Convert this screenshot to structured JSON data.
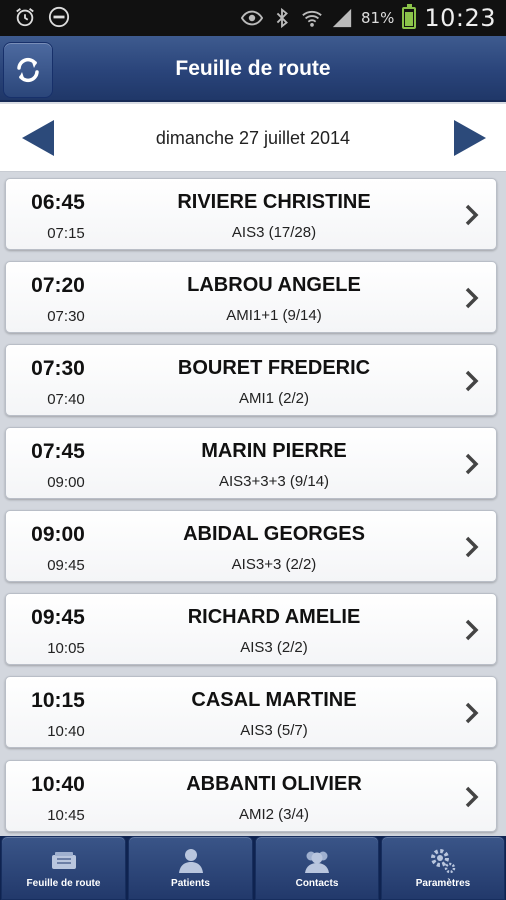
{
  "status_bar": {
    "battery_percent": "81%",
    "time": "10:23",
    "icons": [
      "alarm-icon",
      "do-not-disturb-icon",
      "eye-icon",
      "bluetooth-icon",
      "wifi-icon",
      "signal-icon",
      "battery-icon"
    ]
  },
  "header": {
    "title": "Feuille de route",
    "sync_icon": "sync-icon"
  },
  "date_nav": {
    "date": "dimanche 27 juillet 2014",
    "prev_icon": "arrow-left-icon",
    "next_icon": "arrow-right-icon"
  },
  "appointments": [
    {
      "start": "06:45",
      "end": "07:15",
      "patient": "RIVIERE CHRISTINE",
      "act": "AIS3 (17/28)"
    },
    {
      "start": "07:20",
      "end": "07:30",
      "patient": "LABROU ANGELE",
      "act": "AMI1+1 (9/14)"
    },
    {
      "start": "07:30",
      "end": "07:40",
      "patient": "BOURET FREDERIC",
      "act": "AMI1 (2/2)"
    },
    {
      "start": "07:45",
      "end": "09:00",
      "patient": "MARIN PIERRE",
      "act": "AIS3+3+3 (9/14)"
    },
    {
      "start": "09:00",
      "end": "09:45",
      "patient": "ABIDAL GEORGES",
      "act": "AIS3+3 (2/2)"
    },
    {
      "start": "09:45",
      "end": "10:05",
      "patient": "RICHARD AMELIE",
      "act": "AIS3 (2/2)"
    },
    {
      "start": "10:15",
      "end": "10:40",
      "patient": "CASAL MARTINE",
      "act": "AIS3 (5/7)"
    },
    {
      "start": "10:40",
      "end": "10:45",
      "patient": "ABBANTI OLIVIER",
      "act": "AMI2 (3/4)"
    }
  ],
  "tabs": [
    {
      "label": "Feuille de route",
      "icon": "roadmap-icon"
    },
    {
      "label": "Patients",
      "icon": "patient-icon"
    },
    {
      "label": "Contacts",
      "icon": "contacts-icon"
    },
    {
      "label": "Paramètres",
      "icon": "settings-icon"
    }
  ],
  "colors": {
    "header": "#2a447a",
    "tabbar": "#22396b",
    "nav_arrow": "#2c4a7a"
  }
}
